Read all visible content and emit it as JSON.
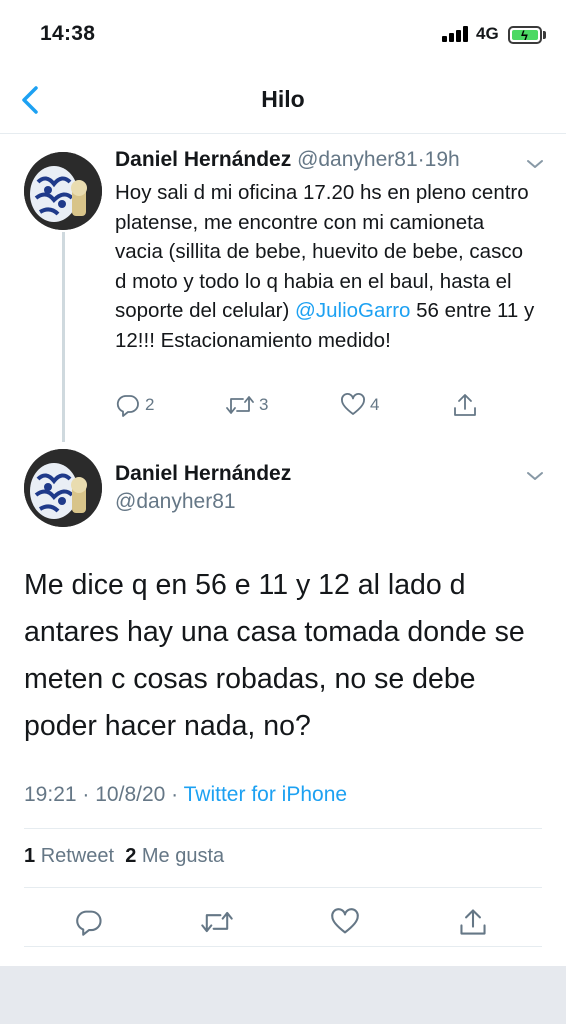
{
  "status_bar": {
    "time": "14:38",
    "network": "4G"
  },
  "nav": {
    "title": "Hilo"
  },
  "thread_tweet": {
    "author_name": "Daniel Hernández",
    "handle": "@danyher81",
    "separator": "·",
    "time": "19h",
    "text_before_mention": "Hoy sali d mi oficina 17.20 hs en pleno centro platense, me encontre con mi camioneta vacia (sillita de bebe, huevito de bebe, casco d moto y todo lo q habia en el baul, hasta el soporte del celular) ",
    "mention": "@JulioGarro",
    "text_after_mention": " 56 entre 11 y 12!!! Estacionamiento medido!",
    "reply_count": "2",
    "retweet_count": "3",
    "like_count": "4"
  },
  "main_tweet": {
    "author_name": "Daniel Hernández",
    "handle": "@danyher81",
    "text": "Me dice q en 56 e 11 y 12 al lado d antares hay una casa tomada donde se meten c cosas robadas, no se debe poder hacer nada, no?",
    "time": "19:21",
    "date_separator": "·",
    "date": "10/8/20",
    "source_separator": "·",
    "source": "Twitter for iPhone",
    "retweets_count": "1",
    "retweets_label": "Retweet",
    "likes_count": "2",
    "likes_label": "Me gusta"
  },
  "colors": {
    "accent": "#1da1f2",
    "secondary_text": "#657786",
    "divider": "#e6ecf0"
  }
}
